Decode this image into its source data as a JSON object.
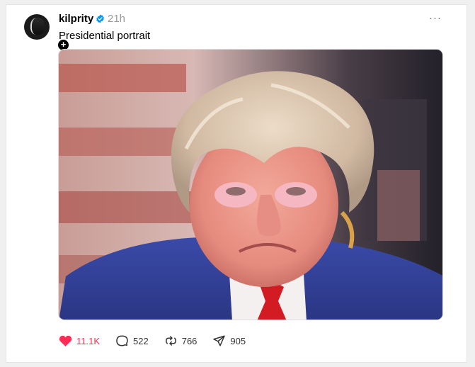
{
  "post": {
    "username": "kilprity",
    "time": "21h",
    "caption": "Presidential portrait",
    "more_label": "···",
    "follow_badge": "+"
  },
  "actions": {
    "like_count": "11.1K",
    "reply_count": "522",
    "repost_count": "766",
    "share_count": "905"
  },
  "colors": {
    "like": "#ff2d55",
    "verified": "#0095f6"
  },
  "icons": [
    "heart-icon",
    "reply-icon",
    "repost-icon",
    "share-icon",
    "verified-icon",
    "more-icon"
  ]
}
